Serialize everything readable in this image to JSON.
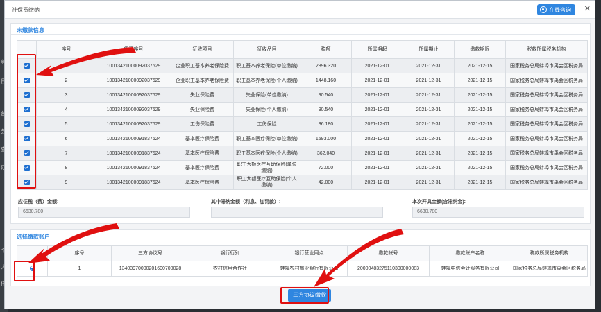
{
  "window": {
    "title": "社保费缴纳",
    "online_help": "在线咨询",
    "close": "×"
  },
  "left_strip": [
    "务",
    "日",
    "台",
    "务",
    "查",
    "办",
    "个",
    "人",
    "仟"
  ],
  "unpaid": {
    "section_title": "未缴款信息",
    "headers": [
      "序号",
      "凭证序号",
      "征收项目",
      "征收品目",
      "税额",
      "所属期起",
      "所属期止",
      "缴款期限",
      "税款所属税务机构"
    ],
    "rows": [
      {
        "seq": "1",
        "voucher": "10013421000092037629",
        "item": "企业职工基本养老保险费",
        "subitem": "职工基本养老保险(单位缴纳)",
        "tax": "2896.320",
        "start": "2021-12-01",
        "end": "2021-12-31",
        "deadline": "2021-12-15",
        "org": "国家税务总局蚌埠市禹会区税务局"
      },
      {
        "seq": "2",
        "voucher": "10013421000092037629",
        "item": "企业职工基本养老保险费",
        "subitem": "职工基本养老保险(个人缴纳)",
        "tax": "1448.160",
        "start": "2021-12-01",
        "end": "2021-12-31",
        "deadline": "2021-12-15",
        "org": "国家税务总局蚌埠市禹会区税务局"
      },
      {
        "seq": "3",
        "voucher": "10013421000092037629",
        "item": "失业保险费",
        "subitem": "失业保险(单位缴纳)",
        "tax": "90.540",
        "start": "2021-12-01",
        "end": "2021-12-31",
        "deadline": "2021-12-15",
        "org": "国家税务总局蚌埠市禹会区税务局"
      },
      {
        "seq": "4",
        "voucher": "10013421000092037629",
        "item": "失业保险费",
        "subitem": "失业保险(个人缴纳)",
        "tax": "90.540",
        "start": "2021-12-01",
        "end": "2021-12-31",
        "deadline": "2021-12-15",
        "org": "国家税务总局蚌埠市禹会区税务局"
      },
      {
        "seq": "5",
        "voucher": "10013421000092037629",
        "item": "工伤保险费",
        "subitem": "工伤保险",
        "tax": "36.180",
        "start": "2021-12-01",
        "end": "2021-12-31",
        "deadline": "2021-12-15",
        "org": "国家税务总局蚌埠市禹会区税务局"
      },
      {
        "seq": "6",
        "voucher": "10013421000091837624",
        "item": "基本医疗保险费",
        "subitem": "职工基本医疗保险(单位缴纳)",
        "tax": "1593.000",
        "start": "2021-12-01",
        "end": "2021-12-31",
        "deadline": "2021-12-15",
        "org": "国家税务总局蚌埠市禹会区税务局"
      },
      {
        "seq": "7",
        "voucher": "10013421000091837624",
        "item": "基本医疗保险费",
        "subitem": "职工基本医疗保险(个人缴纳)",
        "tax": "362.040",
        "start": "2021-12-01",
        "end": "2021-12-31",
        "deadline": "2021-12-15",
        "org": "国家税务总局蚌埠市禹会区税务局"
      },
      {
        "seq": "8",
        "voucher": "10013421000091837624",
        "item": "基本医疗保险费",
        "subitem": "职工大额医疗互助保险(单位缴纳)",
        "tax": "72.000",
        "start": "2021-12-01",
        "end": "2021-12-31",
        "deadline": "2021-12-15",
        "org": "国家税务总局蚌埠市禹会区税务局"
      },
      {
        "seq": "9",
        "voucher": "10013421000091837624",
        "item": "基本医疗保险费",
        "subitem": "职工大额医疗互助保险(个人缴纳)",
        "tax": "42.000",
        "start": "2021-12-01",
        "end": "2021-12-31",
        "deadline": "2021-12-15",
        "org": "国家税务总局蚌埠市禹会区税务局"
      }
    ],
    "amount_due_label": "应征税（费）金额:",
    "amount_due_value": "6630.780",
    "late_fee_label": "其中滞纳金额（利息、加罚款）:",
    "late_fee_value": "",
    "invoice_total_label": "本次开具金额(含滞纳金):",
    "invoice_total_value": "6630.780"
  },
  "account": {
    "section_title": "选择缴款账户",
    "headers": [
      "序号",
      "三方协议号",
      "银行行别",
      "银行营业网点",
      "缴款帐号",
      "缴款账户名称",
      "税款所属税务机构"
    ],
    "rows": [
      {
        "seq": "1",
        "agreement": "13403970000201600700028",
        "bank_type": "农村信用合作社",
        "branch": "蚌埠农村商业银行有限公司",
        "account_no": "20000483275110300000083",
        "account_name": "蚌埠中信会计服务有限公司",
        "org": "国家税务总局蚌埠市禹会区税务局"
      }
    ]
  },
  "pay_button": "三方协议缴款",
  "colors": {
    "accent": "#2f86e0",
    "highlight": "#e01010"
  }
}
